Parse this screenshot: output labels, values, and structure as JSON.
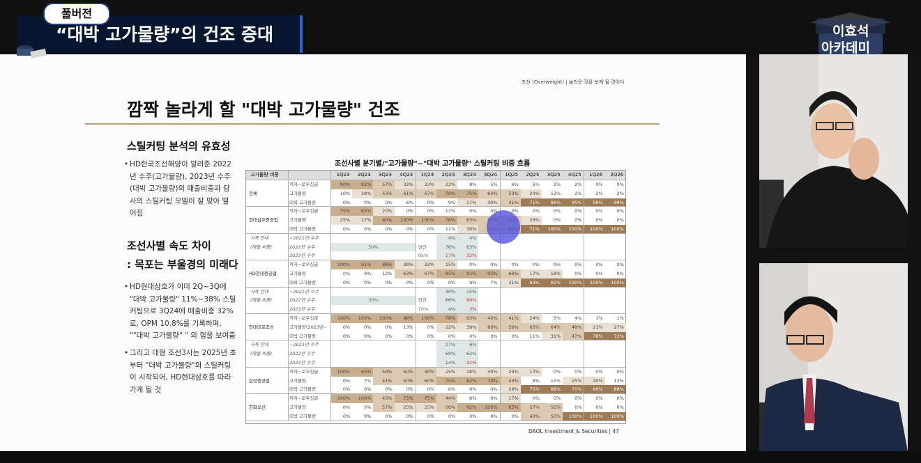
{
  "video": {
    "badge": "풀버전",
    "title": "“대박 고가물량”의 건조 증대",
    "logo_line1": "이효석",
    "logo_line2": "아카데미"
  },
  "slide": {
    "tag": "조선 (Overweight)  |  놀라운 것을 보게 될 것이다",
    "title": "깜짝 놀라게 할 \"대박 고가물량\" 건조",
    "section1_title": "스틸커팅 분석의 유효성",
    "section1_bullet": "HD한국조선해양이 알려준 2022년 수주(고가물량), 2023년 수주(대박 고가물량)의 매출비중과 당사의 스틸커팅 모델이 잘 맞아 떨어짐",
    "section2_title_line1": "조선사별 속도 차이",
    "section2_title_line2": ": 목포는 부울경의 미래다",
    "section2_bullet1": "HD현대삼호가 이미 2Q~3Q에 \"대박 고가물량\" 11%~38% 스틸커팅으로 3Q24에 매출비중 32%로, OPM 10.8%를 기록하며, \"\"대박 고가물량\" \" 의 힘을 보여줌",
    "section2_bullet2": "그리고 대형 조선3사는 2025년 초부터 \"대박 고가물량\"의 스틸커팅이 시작되어, HD현대삼호를 따라가게 될 것",
    "footer": "DAOL Investment & Securities  |  47"
  },
  "table": {
    "title": "조선사별 분기별/\"고가물량\"~\"대박 고가물량\" 스틸커팅 비중 흐름",
    "corner": "고가물량 비중",
    "quarters": [
      "1Q23",
      "2Q23",
      "3Q23",
      "4Q23",
      "1Q24",
      "2Q24",
      "3Q24",
      "4Q24",
      "1Q25",
      "2Q25",
      "3Q25",
      "4Q25",
      "1Q26",
      "2Q26"
    ],
    "rows": [
      {
        "company": "전체",
        "label": "적자~로우싱글",
        "values": [
          "90%",
          "82%",
          "57%",
          "32%",
          "33%",
          "22%",
          "8%",
          "5%",
          "6%",
          "5%",
          "2%",
          "2%",
          "0%",
          "0%"
        ]
      },
      {
        "company": "",
        "label": "고가물량",
        "values": [
          "10%",
          "18%",
          "43%",
          "61%",
          "67%",
          "70%",
          "75%",
          "64%",
          "53%",
          "24%",
          "12%",
          "2%",
          "2%",
          "2%"
        ]
      },
      {
        "company": "",
        "label": "대박 고가물량",
        "values": [
          "0%",
          "0%",
          "0%",
          "6%",
          "0%",
          "9%",
          "17%",
          "30%",
          "41%",
          "71%",
          "86%",
          "95%",
          "98%",
          "98%"
        ]
      },
      {
        "company": "현대삼호중공업",
        "label": "적자~로우싱글",
        "values": [
          "75%",
          "83%",
          "20%",
          "0%",
          "0%",
          "11%",
          "0%",
          "0%",
          "0%",
          "0%",
          "0%",
          "0%",
          "0%",
          "0%"
        ]
      },
      {
        "company": "",
        "label": "고가물량",
        "values": [
          "25%",
          "17%",
          "80%",
          "100%",
          "100%",
          "78%",
          "63%",
          "57%",
          "44%",
          "29%",
          "0%",
          "0%",
          "0%",
          "0%"
        ]
      },
      {
        "company": "",
        "label": "대박 고가물량",
        "values": [
          "0%",
          "0%",
          "0%",
          "0%",
          "0%",
          "11%",
          "38%",
          "43%",
          "56%",
          "71%",
          "100%",
          "100%",
          "100%",
          "100%"
        ]
      },
      {
        "company": "HD현대중공업",
        "label": "적자~로우싱글",
        "values": [
          "100%",
          "91%",
          "88%",
          "38%",
          "33%",
          "15%",
          "0%",
          "0%",
          "0%",
          "0%",
          "0%",
          "0%",
          "0%",
          "0%"
        ]
      },
      {
        "company": "",
        "label": "고가물량",
        "values": [
          "0%",
          "9%",
          "12%",
          "63%",
          "67%",
          "85%",
          "91%",
          "93%",
          "69%",
          "17%",
          "18%",
          "0%",
          "0%",
          "0%"
        ]
      },
      {
        "company": "",
        "label": "대박 고가물량",
        "values": [
          "0%",
          "0%",
          "0%",
          "0%",
          "0%",
          "0%",
          "9%",
          "7%",
          "31%",
          "83%",
          "82%",
          "100%",
          "100%",
          "100%"
        ]
      },
      {
        "company": "현대미포조선",
        "label": "적자~로우싱글",
        "values": [
          "100%",
          "100%",
          "100%",
          "88%",
          "100%",
          "78%",
          "63%",
          "40%",
          "41%",
          "24%",
          "5%",
          "4%",
          "1%",
          "1%"
        ]
      },
      {
        "company": "",
        "label": "고가물량(2023년~",
        "values": [
          "0%",
          "0%",
          "0%",
          "13%",
          "0%",
          "22%",
          "38%",
          "60%",
          "59%",
          "65%",
          "64%",
          "48%",
          "21%",
          "27%"
        ]
      },
      {
        "company": "",
        "label": "대박 고가물량",
        "values": [
          "0%",
          "0%",
          "0%",
          "0%",
          "0%",
          "0%",
          "0%",
          "0%",
          "0%",
          "11%",
          "31%",
          "47%",
          "78%",
          "72%"
        ]
      },
      {
        "company": "삼성중공업",
        "label": "적자~로우싱글",
        "values": [
          "100%",
          "93%",
          "59%",
          "50%",
          "40%",
          "25%",
          "18%",
          "30%",
          "29%",
          "17%",
          "0%",
          "0%",
          "0%",
          "0%"
        ]
      },
      {
        "company": "",
        "label": "고가물량",
        "values": [
          "0%",
          "7%",
          "41%",
          "50%",
          "60%",
          "75%",
          "82%",
          "70%",
          "43%",
          "8%",
          "11%",
          "25%",
          "20%",
          "13%"
        ]
      },
      {
        "company": "",
        "label": "대박 고가물량",
        "values": [
          "0%",
          "0%",
          "0%",
          "0%",
          "0%",
          "0%",
          "0%",
          "0%",
          "29%",
          "75%",
          "89%",
          "75%",
          "80%",
          "88%"
        ]
      },
      {
        "company": "한화오션",
        "label": "적자~로우싱글",
        "values": [
          "100%",
          "100%",
          "43%",
          "75%",
          "75%",
          "44%",
          "8%",
          "0%",
          "17%",
          "0%",
          "0%",
          "0%",
          "0%",
          "0%"
        ]
      },
      {
        "company": "",
        "label": "고가물량",
        "values": [
          "0%",
          "0%",
          "57%",
          "25%",
          "25%",
          "56%",
          "92%",
          "100%",
          "83%",
          "57%",
          "50%",
          "0%",
          "0%",
          "0%"
        ]
      },
      {
        "company": "",
        "label": "대박 고가물량",
        "values": [
          "0%",
          "0%",
          "0%",
          "0%",
          "0%",
          "0%",
          "0%",
          "0%",
          "0%",
          "43%",
          "50%",
          "100%",
          "100%",
          "100%"
        ]
      }
    ],
    "sales_blocks": [
      {
        "left1": "사측 안내",
        "left2": "(매출 비중)",
        "l1": "~2021년 수주",
        "l2": "2022년 수주",
        "l3": "2023년 수주",
        "mid": "50%",
        "mid2": "연간",
        "mid3": "95%",
        "a": [
          "4%",
          "78%",
          "17%"
        ],
        "b": [
          "4%",
          "63%",
          "32%"
        ]
      },
      {
        "left1": "사측 안내",
        "left2": "(매출 비중)",
        "l1": "~2021년 수주",
        "l2": "2022년 수주",
        "l3": "2023년 수주",
        "mid": "30%",
        "mid2": "연간",
        "mid3": "70%",
        "a": [
          "30%",
          "66%",
          "4%"
        ],
        "b": [
          "15%",
          "80%",
          "3%"
        ]
      },
      {
        "left1": "사측 안내",
        "left2": "(매출 비중)",
        "l1": "~2021년 수주",
        "l2": "2022년 수주",
        "l3": "2023년 수주",
        "mid": "",
        "mid2": "",
        "mid3": "",
        "a": [
          "17%",
          "69%",
          "14%"
        ],
        "b": [
          "6%",
          "62%",
          "32%"
        ]
      }
    ]
  }
}
